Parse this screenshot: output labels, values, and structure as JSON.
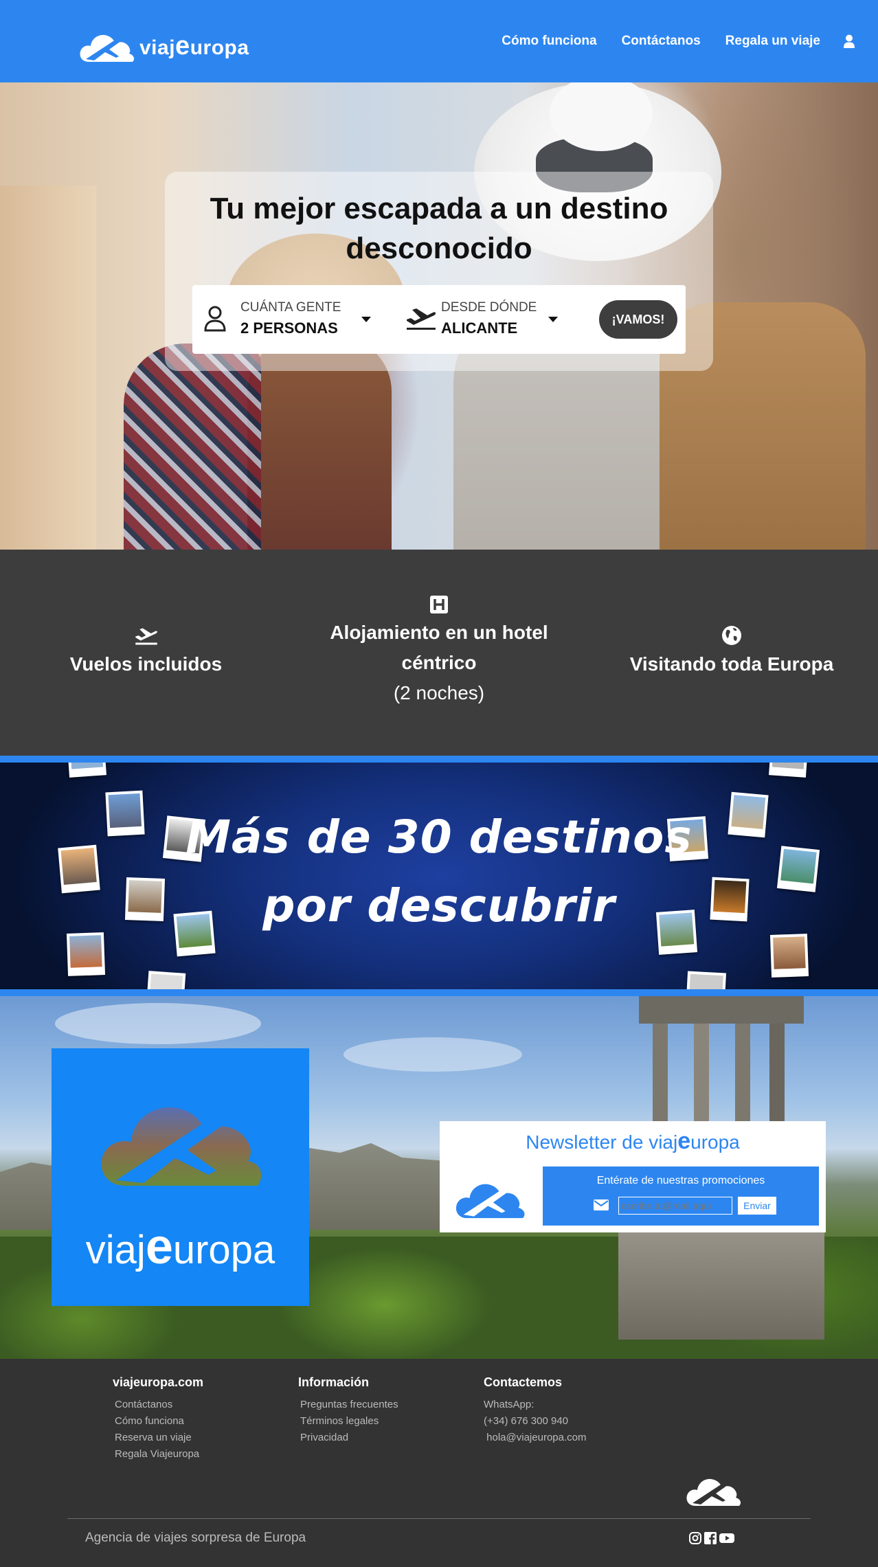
{
  "header": {
    "brand_pre": "viaj",
    "brand_e": "e",
    "brand_post": "uropa",
    "links": [
      "Cómo funciona",
      "Contáctanos",
      "Regala un viaje"
    ],
    "user_icon": "user-icon"
  },
  "hero": {
    "title": "Tu mejor escapada a un destino desconocido",
    "people_label": "CUÁNTA GENTE",
    "people_value": "2 PERSONAS",
    "origin_label": "DESDE DÓNDE",
    "origin_value": "ALICANTE",
    "cta": "¡VAMOS!"
  },
  "features": {
    "flights": "Vuelos incluidos",
    "hotel_line1": "Alojamiento en un hotel",
    "hotel_line2": "céntrico",
    "hotel_line3": "(2 noches)",
    "europe": "Visitando toda Europa"
  },
  "banner": {
    "line1": "Más de 30 destinos",
    "line2": "por descubrir"
  },
  "newsletter": {
    "title_pre": "Newsletter de viaj",
    "title_e": "e",
    "title_post": "uropa",
    "message": "Entérate de nuestras promociones",
    "placeholder": "escribe.tu@mail.aqui",
    "button": "Enviar"
  },
  "brand_square": {
    "pre": "viaj",
    "e": "e",
    "post": "uropa"
  },
  "footer": {
    "col1_title": "viajeuropa.com",
    "col1_items": [
      "Contáctanos",
      "Cómo funciona",
      "Reserva un viaje",
      "Regala Viajeuropa"
    ],
    "col2_title": "Información",
    "col2_items": [
      "Preguntas frecuentes",
      "Términos legales",
      "Privacidad"
    ],
    "col3_title": "Contactemos",
    "col3_items": [
      "WhatsApp:",
      "(+34) 676 300 940",
      " hola@viajeuropa.com"
    ],
    "tagline": "Agencia de viajes sorpresa de Europa",
    "social": [
      "instagram-icon",
      "facebook-icon",
      "youtube-icon"
    ]
  },
  "colors": {
    "brand_blue": "#2d86f0",
    "dark_gray": "#3d3d3d",
    "footer_gray": "#333333"
  }
}
